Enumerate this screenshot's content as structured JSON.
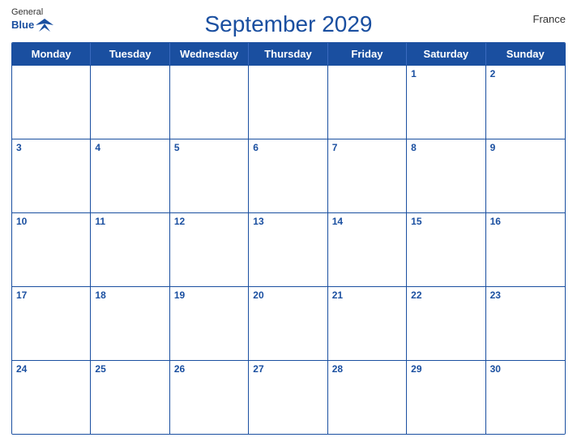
{
  "header": {
    "title": "September 2029",
    "country": "France",
    "logo": {
      "line1": "General",
      "line2": "Blue"
    }
  },
  "weekdays": [
    "Monday",
    "Tuesday",
    "Wednesday",
    "Thursday",
    "Friday",
    "Saturday",
    "Sunday"
  ],
  "weeks": [
    [
      {
        "day": "",
        "empty": true
      },
      {
        "day": "",
        "empty": true
      },
      {
        "day": "",
        "empty": true
      },
      {
        "day": "",
        "empty": true
      },
      {
        "day": "",
        "empty": true
      },
      {
        "day": "1"
      },
      {
        "day": "2"
      }
    ],
    [
      {
        "day": "3"
      },
      {
        "day": "4"
      },
      {
        "day": "5"
      },
      {
        "day": "6"
      },
      {
        "day": "7"
      },
      {
        "day": "8"
      },
      {
        "day": "9"
      }
    ],
    [
      {
        "day": "10"
      },
      {
        "day": "11"
      },
      {
        "day": "12"
      },
      {
        "day": "13"
      },
      {
        "day": "14"
      },
      {
        "day": "15"
      },
      {
        "day": "16"
      }
    ],
    [
      {
        "day": "17"
      },
      {
        "day": "18"
      },
      {
        "day": "19"
      },
      {
        "day": "20"
      },
      {
        "day": "21"
      },
      {
        "day": "22"
      },
      {
        "day": "23"
      }
    ],
    [
      {
        "day": "24"
      },
      {
        "day": "25"
      },
      {
        "day": "26"
      },
      {
        "day": "27"
      },
      {
        "day": "28"
      },
      {
        "day": "29"
      },
      {
        "day": "30"
      }
    ]
  ],
  "colors": {
    "primary": "#1a4fa0",
    "header_bg": "#1a4fa0",
    "header_text": "#ffffff",
    "day_num": "#1a4fa0",
    "border": "#1a4fa0"
  }
}
